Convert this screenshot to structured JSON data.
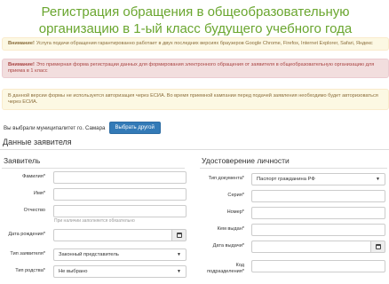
{
  "page": {
    "title": "Регистрация обращения в общеобразовательную организацию в 1-ый класс будущего учебного года"
  },
  "alerts": {
    "warning1_bold": "Внимание!",
    "warning1_text": "Услуга подачи обращения гарантированно работает в двух последних версиях браузеров Google Chrome, Firefox, Internet Explorer, Safari, Яндекс",
    "danger_bold": "Внимание!",
    "danger_text": "Это примерная форма регистрации данных для формирования электронного обращения от заявителя в общеобразовательную организацию для приема в 1 класс",
    "warning2_text": "В данной версии формы не используется авторизация через ЕСИА. Во время приемной кампании перед подачей заявления необходимо будет авторизоваться через ЕСИА."
  },
  "municipality": {
    "text": "Вы выбрали муниципалитет го. Самара",
    "button_label": "Выбрать другой"
  },
  "section_title": "Данные заявителя",
  "applicant": {
    "heading": "Заявитель",
    "surname_label": "Фамилия*",
    "name_label": "Имя*",
    "patronymic_label": "Отчество",
    "patronymic_help": "При наличии заполняется обязательно",
    "birthdate_label": "Дата рождения*",
    "applicant_type_label": "Тип заявителя*",
    "applicant_type_value": "Законный представитель",
    "kinship_label": "Тип родства*",
    "kinship_value": "Не выбрано"
  },
  "identity": {
    "heading": "Удостоверение личности",
    "doc_type_label": "Тип документа*",
    "doc_type_value": "Паспорт гражданина РФ",
    "series_label": "Серия*",
    "number_label": "Номер*",
    "issued_by_label": "Кем выдан*",
    "issue_date_label": "Дата выдачи*",
    "division_code_label": "Код подразделения*"
  },
  "colors": {
    "title_green": "#6aa62f",
    "primary_blue": "#337ab7",
    "warning_bg": "#fcf8e3",
    "danger_bg": "#f2dede"
  },
  "icons": {
    "calendar": "calendar-icon",
    "select_caret": "caret-down-icon"
  }
}
